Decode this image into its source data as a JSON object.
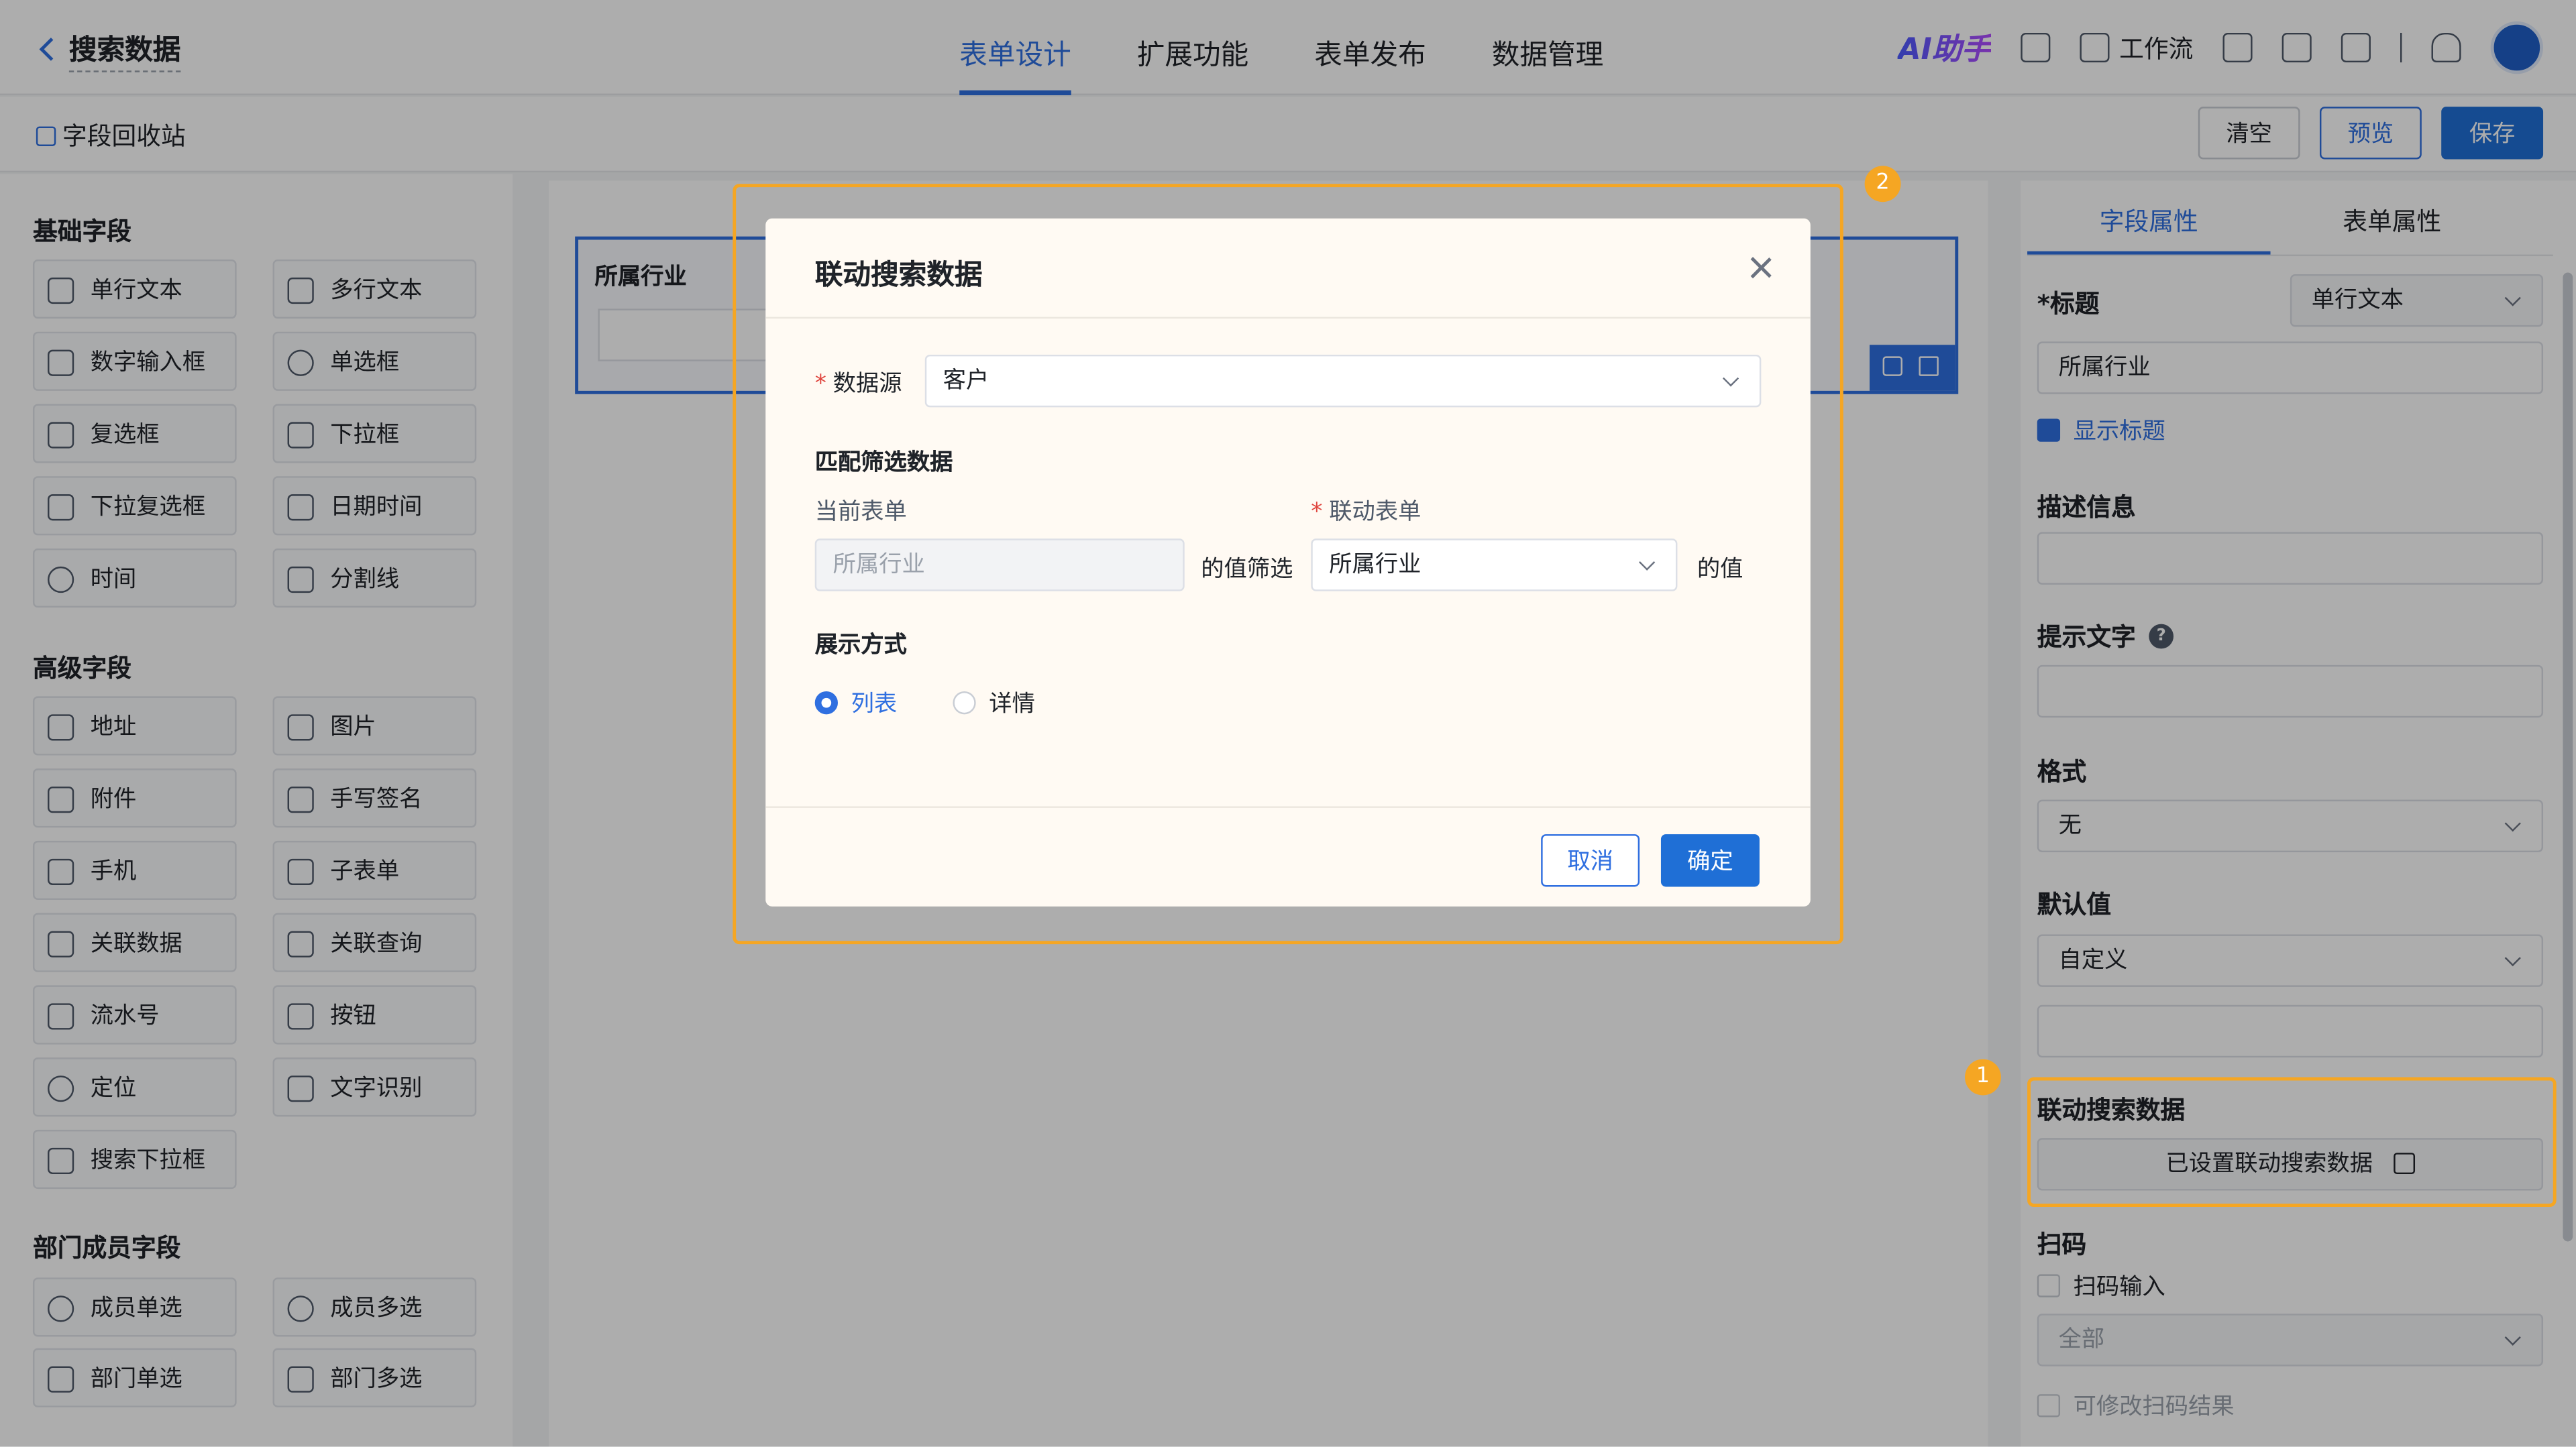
{
  "header": {
    "back_title": "搜索数据",
    "tabs": [
      "表单设计",
      "扩展功能",
      "表单发布",
      "数据管理"
    ],
    "active_tab": "表单设计",
    "ai": "AI助手",
    "workflow": "工作流"
  },
  "subbar": {
    "recycle": "字段回收站",
    "clear": "清空",
    "preview": "预览",
    "save": "保存"
  },
  "left": {
    "basic_title": "基础字段",
    "basic": [
      "单行文本",
      "多行文本",
      "数字输入框",
      "单选框",
      "复选框",
      "下拉框",
      "下拉复选框",
      "日期时间",
      "时间",
      "分割线"
    ],
    "advanced_title": "高级字段",
    "advanced": [
      "地址",
      "图片",
      "附件",
      "手写签名",
      "手机",
      "子表单",
      "关联数据",
      "关联查询",
      "流水号",
      "按钮",
      "定位",
      "文字识别",
      "搜索下拉框"
    ],
    "member_title": "部门成员字段",
    "member": [
      "成员单选",
      "成员多选",
      "部门单选",
      "部门多选"
    ]
  },
  "canvas": {
    "field_label": "所属行业"
  },
  "right": {
    "tabs": [
      "字段属性",
      "表单属性"
    ],
    "title_label": "*标题",
    "type_value": "单行文本",
    "title_value": "所属行业",
    "show_title": "显示标题",
    "desc_label": "描述信息",
    "hint_label": "提示文字",
    "format_label": "格式",
    "format_value": "无",
    "default_label": "默认值",
    "default_value": "自定义",
    "linked_label": "联动搜索数据",
    "linked_btn": "已设置联动搜索数据",
    "scan_label": "扫码",
    "scan_input": "扫码输入",
    "scan_value": "全部",
    "scan_edit": "可修改扫码结果"
  },
  "modal": {
    "title": "联动搜索数据",
    "source_label": "数据源",
    "source_value": "客户",
    "match_title": "匹配筛选数据",
    "current_form": "当前表单",
    "linked_form": "联动表单",
    "current_value": "所属行业",
    "filter_text": "的值筛选",
    "linked_value": "所属行业",
    "value_text": "的值",
    "display_title": "展示方式",
    "opt_list": "列表",
    "opt_detail": "详情",
    "cancel": "取消",
    "confirm": "确定"
  },
  "badges": {
    "one": "1",
    "two": "2"
  },
  "colors": {
    "primary": "#2f6fe0",
    "highlight": "#f5a623"
  }
}
